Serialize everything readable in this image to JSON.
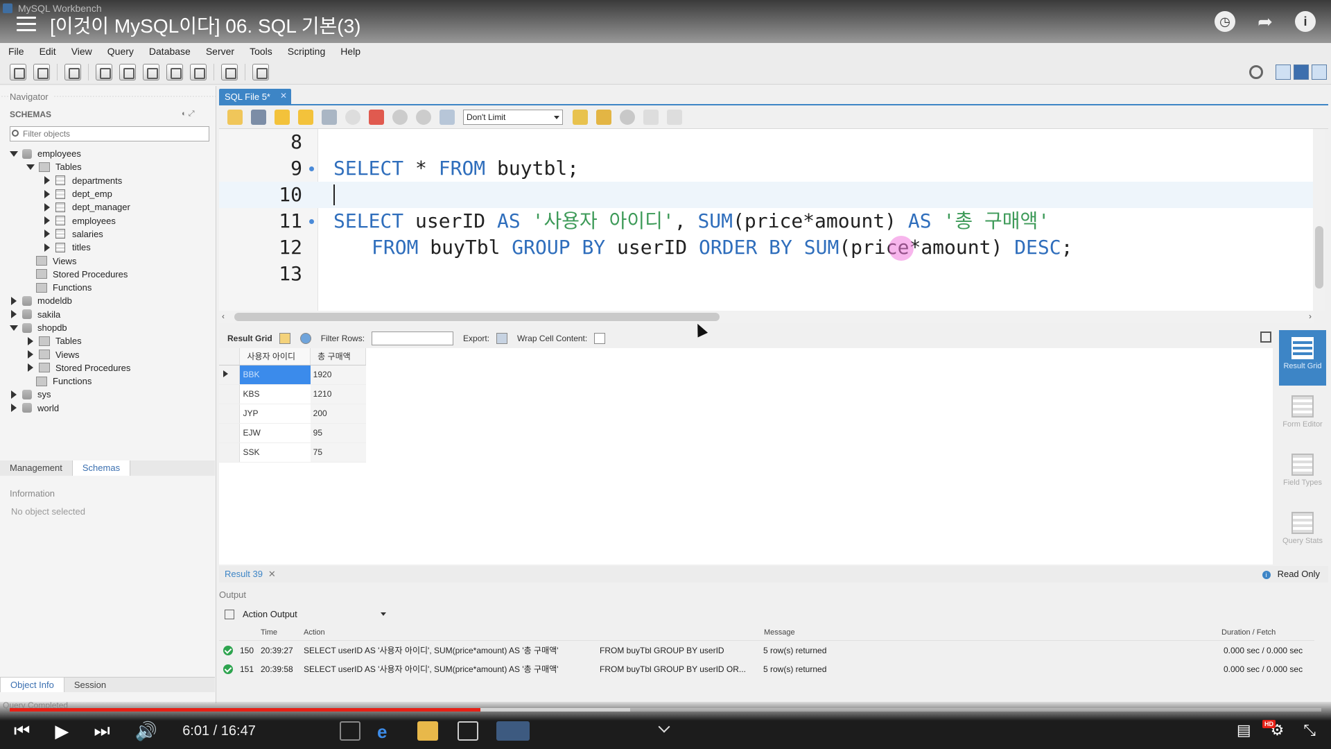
{
  "window": {
    "app_title": "MySQL Workbench"
  },
  "video": {
    "title": "[이것이 MySQL이다] 06. SQL 기본(3)",
    "current_time": "6:01",
    "duration": "16:47",
    "time_display": "6:01 / 16:47",
    "progress_fraction": 0.359,
    "loaded_fraction": 0.473,
    "hd_badge": "HD"
  },
  "menu": [
    "File",
    "Edit",
    "View",
    "Query",
    "Database",
    "Server",
    "Tools",
    "Scripting",
    "Help"
  ],
  "navigator": {
    "title": "Navigator",
    "schemas_label": "SCHEMAS",
    "filter_placeholder": "Filter objects",
    "tree": {
      "employees": "employees",
      "tables": "Tables",
      "t_departments": "departments",
      "t_dept_emp": "dept_emp",
      "t_dept_manager": "dept_manager",
      "t_employees": "employees",
      "t_salaries": "salaries",
      "t_titles": "titles",
      "views": "Views",
      "stored_procedures": "Stored Procedures",
      "functions": "Functions",
      "modeldb": "modeldb",
      "sakila": "sakila",
      "shopdb": "shopdb",
      "shop_tables": "Tables",
      "shop_views": "Views",
      "shop_sp": "Stored Procedures",
      "shop_functions": "Functions",
      "sys": "sys",
      "world": "world"
    },
    "tabs": {
      "management": "Management",
      "schemas": "Schemas"
    },
    "information_label": "Information",
    "no_object": "No object selected",
    "info_tabs": {
      "object_info": "Object Info",
      "session": "Session"
    }
  },
  "editor": {
    "tab_label": "SQL File 5*",
    "limit": "Don't Limit",
    "lines": {
      "n8": "8",
      "n9": "9",
      "n10": "10",
      "n11": "11",
      "n12": "12",
      "n13": "13"
    },
    "code": {
      "l9_kw1": "SELECT",
      "l9_rest1": " * ",
      "l9_kw2": "FROM",
      "l9_rest2": " buytbl;",
      "l11_kw1": "SELECT",
      "l11_rest1": " userID ",
      "l11_kw2": "AS",
      "l11_str1": " '사용자 아이디'",
      "l11_rest2": ", ",
      "l11_kw3": "SUM",
      "l11_rest3": "(price*amount) ",
      "l11_kw4": "AS",
      "l11_str2": " '총 구매액'",
      "l12_kw1": "FROM",
      "l12_rest1": " buyTbl ",
      "l12_kw2": "GROUP BY",
      "l12_rest2": " userID ",
      "l12_kw3": "ORDER BY",
      "l12_kw4": " SUM",
      "l12_rest3": "(price*amount) ",
      "l12_kw5": "DESC",
      "l12_rest4": ";"
    }
  },
  "result_toolbar": {
    "result_grid": "Result Grid",
    "filter_rows": "Filter Rows:",
    "export": "Export:",
    "wrap": "Wrap Cell Content:"
  },
  "result_grid": {
    "columns": [
      "사용자 아이디",
      "총 구매액"
    ],
    "rows": [
      [
        "BBK",
        "1920"
      ],
      [
        "KBS",
        "1210"
      ],
      [
        "JYP",
        "200"
      ],
      [
        "EJW",
        "95"
      ],
      [
        "SSK",
        "75"
      ]
    ]
  },
  "side_panel": {
    "result_grid": "Result Grid",
    "form_editor": "Form Editor",
    "field_types": "Field Types",
    "query_stats": "Query Stats"
  },
  "result_tab": {
    "label": "Result 39",
    "read_only": "Read Only"
  },
  "output": {
    "title": "Output",
    "selector": "Action Output",
    "headers": {
      "time": "Time",
      "action": "Action",
      "message": "Message",
      "duration": "Duration / Fetch"
    },
    "rows": [
      {
        "num": "150",
        "time": "20:39:27",
        "action": "SELECT userID AS '사용자 아이디', SUM(price*amount) AS '총 구매액'",
        "action2": "FROM buyTbl GROUP BY userID",
        "message": "5 row(s) returned",
        "duration": "0.000 sec / 0.000 sec"
      },
      {
        "num": "151",
        "time": "20:39:58",
        "action": "SELECT userID AS '사용자 아이디', SUM(price*amount) AS '총 구매액'",
        "action2": "FROM buyTbl GROUP BY userID OR...",
        "message": "5 row(s) returned",
        "duration": "0.000 sec / 0.000 sec"
      }
    ]
  },
  "status": "Query Completed"
}
